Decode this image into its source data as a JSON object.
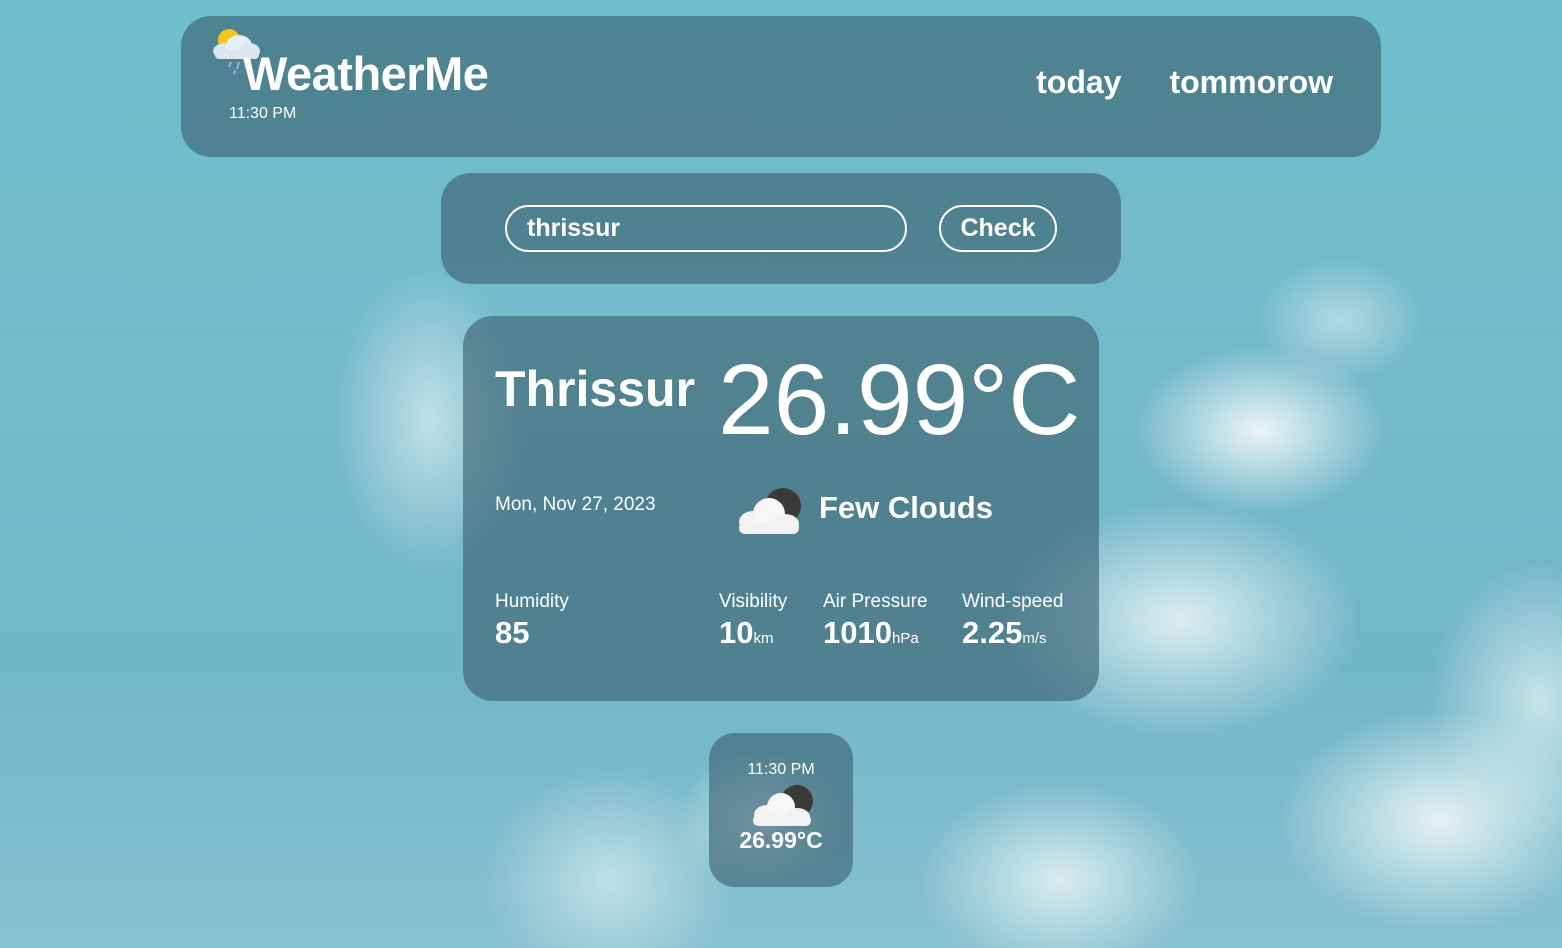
{
  "header": {
    "brand": "WeatherMe",
    "time": "11:30 PM",
    "logo_icon": "sun-cloud-rain-icon",
    "nav": {
      "today": "today",
      "tomorrow": "tommorow"
    }
  },
  "search": {
    "value": "thrissur",
    "button_label": "Check"
  },
  "current": {
    "city": "Thrissur",
    "temperature": "26.99°C",
    "date": "Mon, Nov 27, 2023",
    "condition": "Few Clouds",
    "condition_icon": "few-clouds-night-icon",
    "stats": {
      "humidity": {
        "label": "Humidity",
        "value": "85"
      },
      "visibility": {
        "label": "Visibility",
        "value": "10",
        "unit": "km"
      },
      "pressure": {
        "label": "Air Pressure",
        "value": "1010",
        "unit": "hPa"
      },
      "wind": {
        "label": "Wind-speed",
        "value": "2.25",
        "unit": "m/s"
      }
    }
  },
  "hourly": [
    {
      "time": "11:30 PM",
      "icon": "few-clouds-night-icon",
      "temperature": "26.99°C"
    }
  ],
  "colors": {
    "panel": "#3a606e",
    "sky": "#72b7c6",
    "text": "#ffffff"
  }
}
